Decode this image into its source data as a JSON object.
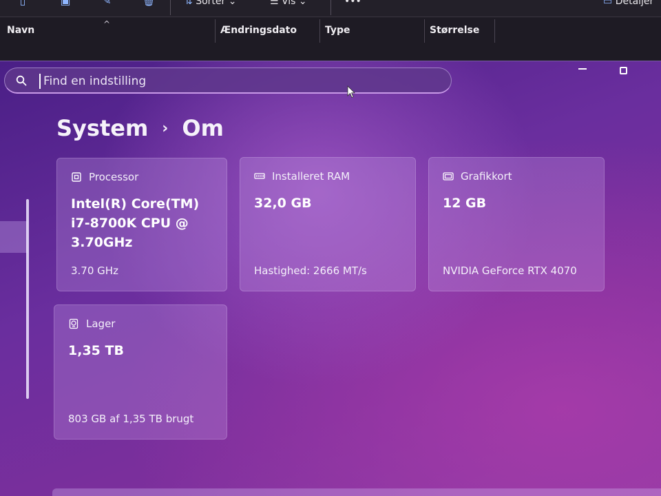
{
  "explorer": {
    "toolbar": {
      "sort_label": "Sorter",
      "view_label": "Vis",
      "more_label": "•••",
      "details_label": "Detaljer"
    },
    "columns": [
      "Navn",
      "Ændringsdato",
      "Type",
      "Størrelse"
    ]
  },
  "search": {
    "placeholder": "Find en indstilling"
  },
  "breadcrumb": {
    "parent": "System",
    "separator": "›",
    "current": "Om"
  },
  "cards": [
    {
      "icon": "processor-icon",
      "label": "Processor",
      "value": "Intel(R) Core(TM) i7-8700K CPU @ 3.70GHz",
      "sub": "3.70 GHz"
    },
    {
      "icon": "ram-icon",
      "label": "Installeret RAM",
      "value": "32,0 GB",
      "sub": "Hastighed: 2666 MT/s"
    },
    {
      "icon": "graphics-card-icon",
      "label": "Grafikkort",
      "value": "12 GB",
      "sub": "NVIDIA GeForce RTX 4070"
    },
    {
      "icon": "storage-icon",
      "label": "Lager",
      "value": "1,35 TB",
      "sub": "803 GB af 1,35 TB brugt"
    }
  ],
  "colors": {
    "background_start": "#4a1f86",
    "background_end": "#8a3aa3",
    "card": "#a07cc8",
    "accent": "#c99ae8"
  }
}
